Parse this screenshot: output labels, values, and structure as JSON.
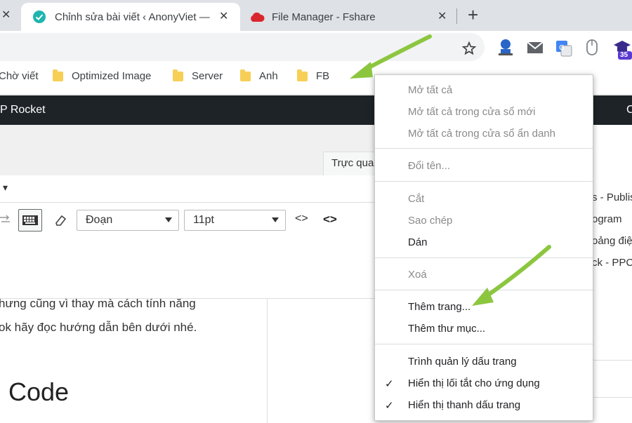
{
  "tabs": [
    {
      "title": "Chỉnh sửa bài viết ‹ AnonyViet —",
      "active": true
    },
    {
      "title": "File Manager - Fshare",
      "active": false
    }
  ],
  "new_tab_symbol": "+",
  "close_symbol": "✕",
  "toolbar": {
    "icons": [
      "star-icon",
      "extension-badge-icon",
      "mail-icon",
      "translate-icon",
      "mouse-icon",
      "graduation-cap-icon"
    ],
    "badge": "35"
  },
  "bookmarks": [
    {
      "label": "Chờ viết",
      "folder": false
    },
    {
      "label": "Optimized Image",
      "folder": true
    },
    {
      "label": "Server",
      "folder": true
    },
    {
      "label": "Anh",
      "folder": true
    },
    {
      "label": "FB",
      "folder": true
    }
  ],
  "admin_bar": {
    "left": "P Rocket",
    "right": "C"
  },
  "editor": {
    "tab_label": "Trực qua",
    "dropdown_caret": "▾",
    "format_select": "Đoạn",
    "size_select": "11pt",
    "code_icon_1": "<>",
    "code_icon_2": "<>"
  },
  "content": {
    "line1": "hưng cũng vì thay mà cách tính năng",
    "line2": "ok hãy đọc hướng dẫn bên dưới nhé.",
    "heading": "Code"
  },
  "side_items": [
    "s - Publis",
    "ogram",
    "oảng điệ",
    "ck - PPC"
  ],
  "context_menu": {
    "groups": [
      [
        {
          "label": "Mở tất cả",
          "enabled": false
        },
        {
          "label": "Mở tất cả trong cửa sổ mới",
          "enabled": false
        },
        {
          "label": "Mở tất cả trong cửa sổ ẩn danh",
          "enabled": false
        }
      ],
      [
        {
          "label": "Đổi tên...",
          "enabled": false
        }
      ],
      [
        {
          "label": "Cắt",
          "enabled": false
        },
        {
          "label": "Sao chép",
          "enabled": false
        },
        {
          "label": "Dán",
          "enabled": true
        }
      ],
      [
        {
          "label": "Xoá",
          "enabled": false
        }
      ],
      [
        {
          "label": "Thêm trang...",
          "enabled": true
        },
        {
          "label": "Thêm thư mục...",
          "enabled": true
        }
      ],
      [
        {
          "label": "Trình quản lý dấu trang",
          "enabled": true,
          "checked": false
        },
        {
          "label": "Hiển thị lối tắt cho ứng dụng",
          "enabled": true,
          "checked": true
        },
        {
          "label": "Hiển thị thanh dấu trang",
          "enabled": true,
          "checked": true
        }
      ]
    ],
    "check_symbol": "✓"
  },
  "colors": {
    "arrow": "#8cc63f",
    "admin_bar": "#1d2327",
    "folder": "#f7cf57"
  }
}
